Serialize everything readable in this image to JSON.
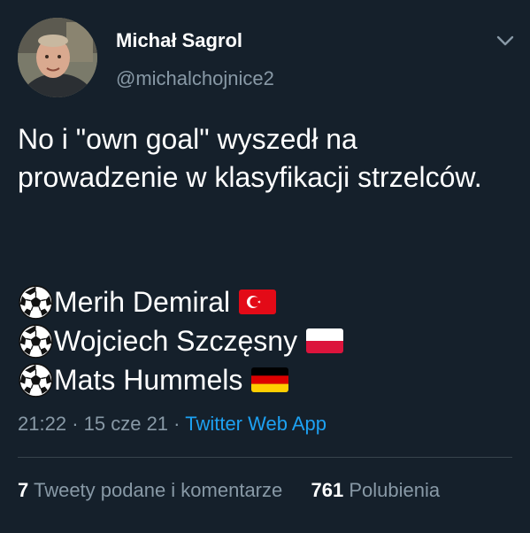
{
  "author": {
    "display_name": "Michał Sagrol",
    "handle": "@michalchojnice2"
  },
  "tweet": {
    "paragraph_1": "No i \"own goal\" wyszedł na prowadzenie w klasyfikacji strzelców.",
    "scorers": [
      {
        "name": "Merih Demiral",
        "flag": "turkey-flag"
      },
      {
        "name": "Wojciech Szczęsny",
        "flag": "poland-flag"
      },
      {
        "name": "Mats Hummels",
        "flag": "germany-flag"
      }
    ],
    "scorer_icon": "soccer-ball-icon"
  },
  "meta": {
    "time": "21:22",
    "separator": "·",
    "date": "15 cze 21",
    "app": "Twitter Web App"
  },
  "stats": {
    "retweets_count": "7",
    "retweets_label": "Tweety podane i komentarze",
    "likes_count": "761",
    "likes_label": "Polubienia"
  },
  "colors": {
    "background": "#15202b",
    "secondary_text": "#8899a6",
    "link": "#1da1f2",
    "divider": "#38444d"
  }
}
